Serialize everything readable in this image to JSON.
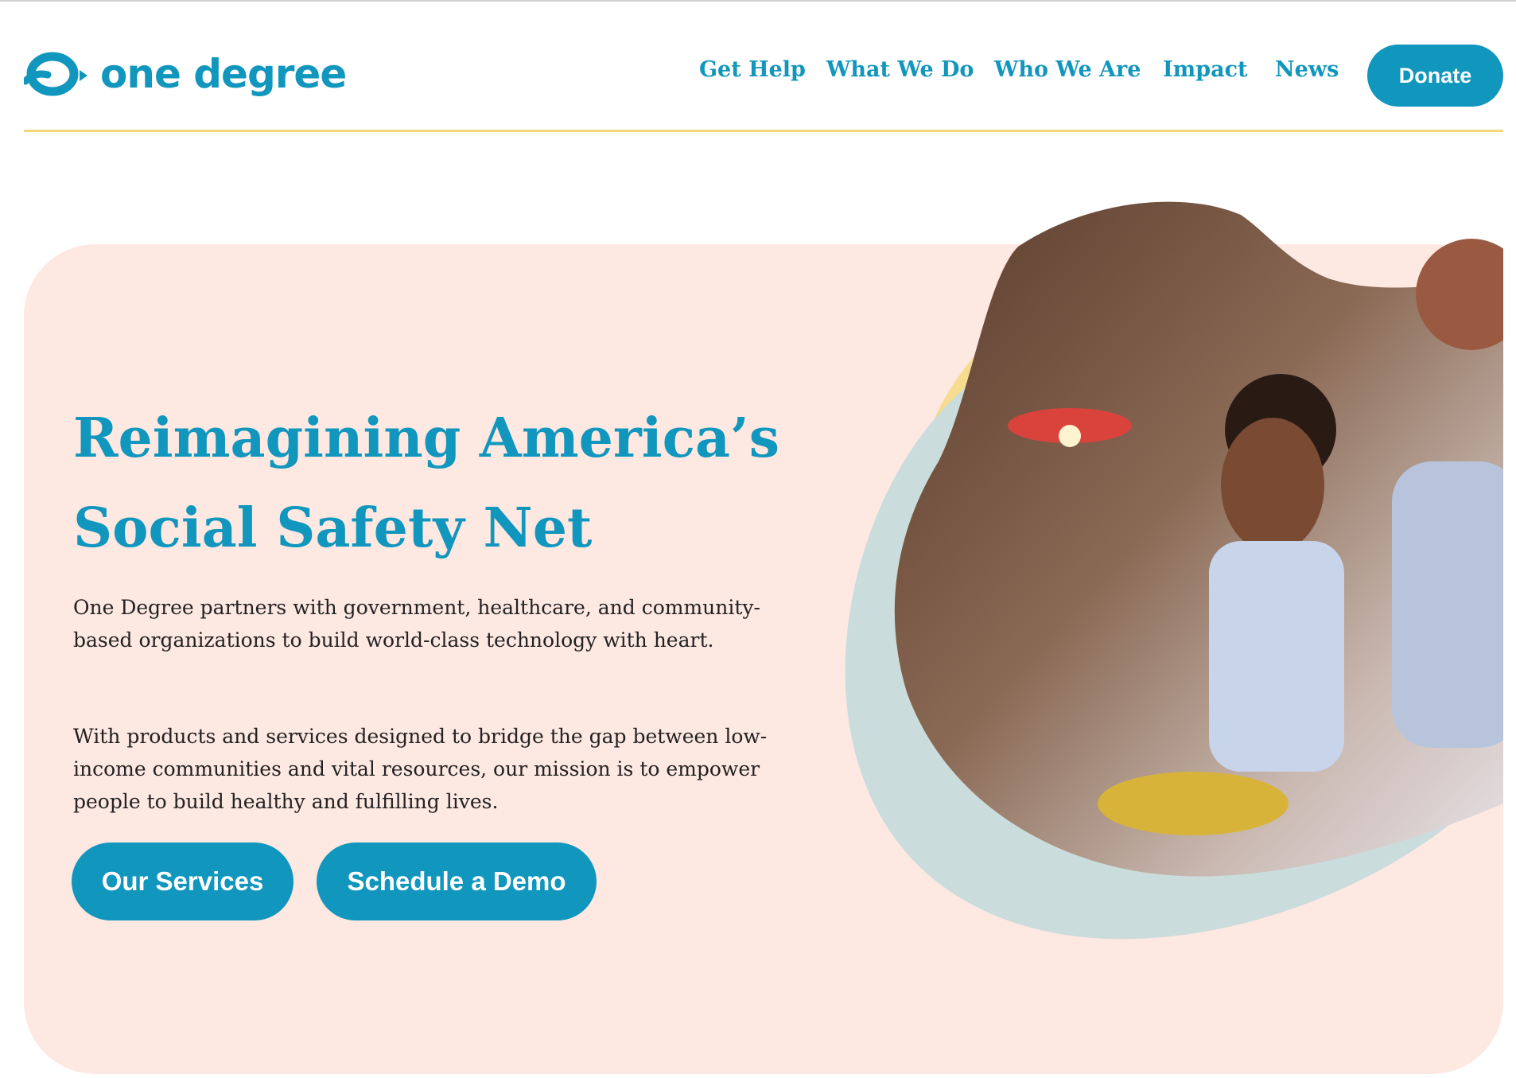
{
  "header": {
    "logo_text": "one degree",
    "nav": [
      "Get Help",
      "What We Do",
      "Who We Are",
      "Impact",
      "News"
    ],
    "donate_label": "Donate"
  },
  "hero": {
    "title_line1": "Reimagining America’s",
    "title_line2": "Social Safety Net",
    "paragraph1": "One Degree partners with government, healthcare, and community-based organizations to build world-class technology with heart.",
    "paragraph2": "With products and services designed to bridge the gap between low-income communities and vital resources, our mission is to empower people to build healthy and fulfilling lives.",
    "primary_button": "Our Services",
    "secondary_button": "Schedule a Demo"
  },
  "colors": {
    "brand_blue": "#1196bd",
    "hero_bg": "#fde8e2",
    "accent_yellow": "#f5d777",
    "blob_teal": "#c9dcdc"
  }
}
